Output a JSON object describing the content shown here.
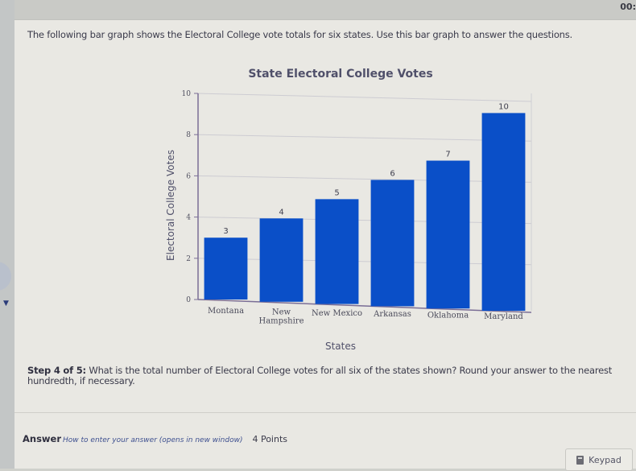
{
  "header": {
    "timer": "00:"
  },
  "intro_text": "The following bar graph shows the Electoral College vote totals for six states. Use this bar graph to answer the questions.",
  "chart_data": {
    "type": "bar",
    "title": "State Electoral College Votes",
    "xlabel": "States",
    "ylabel": "Electoral College Votes",
    "categories": [
      "Montana",
      "New Hampshire",
      "New Mexico",
      "Arkansas",
      "Oklahoma",
      "Maryland"
    ],
    "category_lines": [
      [
        "Montana"
      ],
      [
        "New",
        "Hampshire"
      ],
      [
        "New Mexico"
      ],
      [
        "Arkansas"
      ],
      [
        "Oklahoma"
      ],
      [
        "Maryland"
      ]
    ],
    "values": [
      3,
      4,
      5,
      6,
      7,
      10
    ],
    "data_labels": [
      "3",
      "4",
      "5",
      "6",
      "7",
      "10"
    ],
    "ylim": [
      0,
      10
    ],
    "yticks": [
      0,
      2,
      4,
      6,
      8,
      10
    ],
    "ytick_labels": [
      "0",
      "2",
      "4",
      "6",
      "8",
      "10"
    ],
    "grid": true,
    "bar_color": "#0a4fc8",
    "legend": "none"
  },
  "question": {
    "step_label": "Step 4 of 5:",
    "text": " What is the total number of Electoral College votes for all six of the states shown? Round your answer to the nearest hundredth, if necessary."
  },
  "answer": {
    "label": "Answer",
    "help_link": "How to enter your answer (opens in new window)",
    "points": "4 Points",
    "keypad_label": "Keypad"
  },
  "sidebar": {
    "toggle_icon": "chevron-down-icon"
  }
}
